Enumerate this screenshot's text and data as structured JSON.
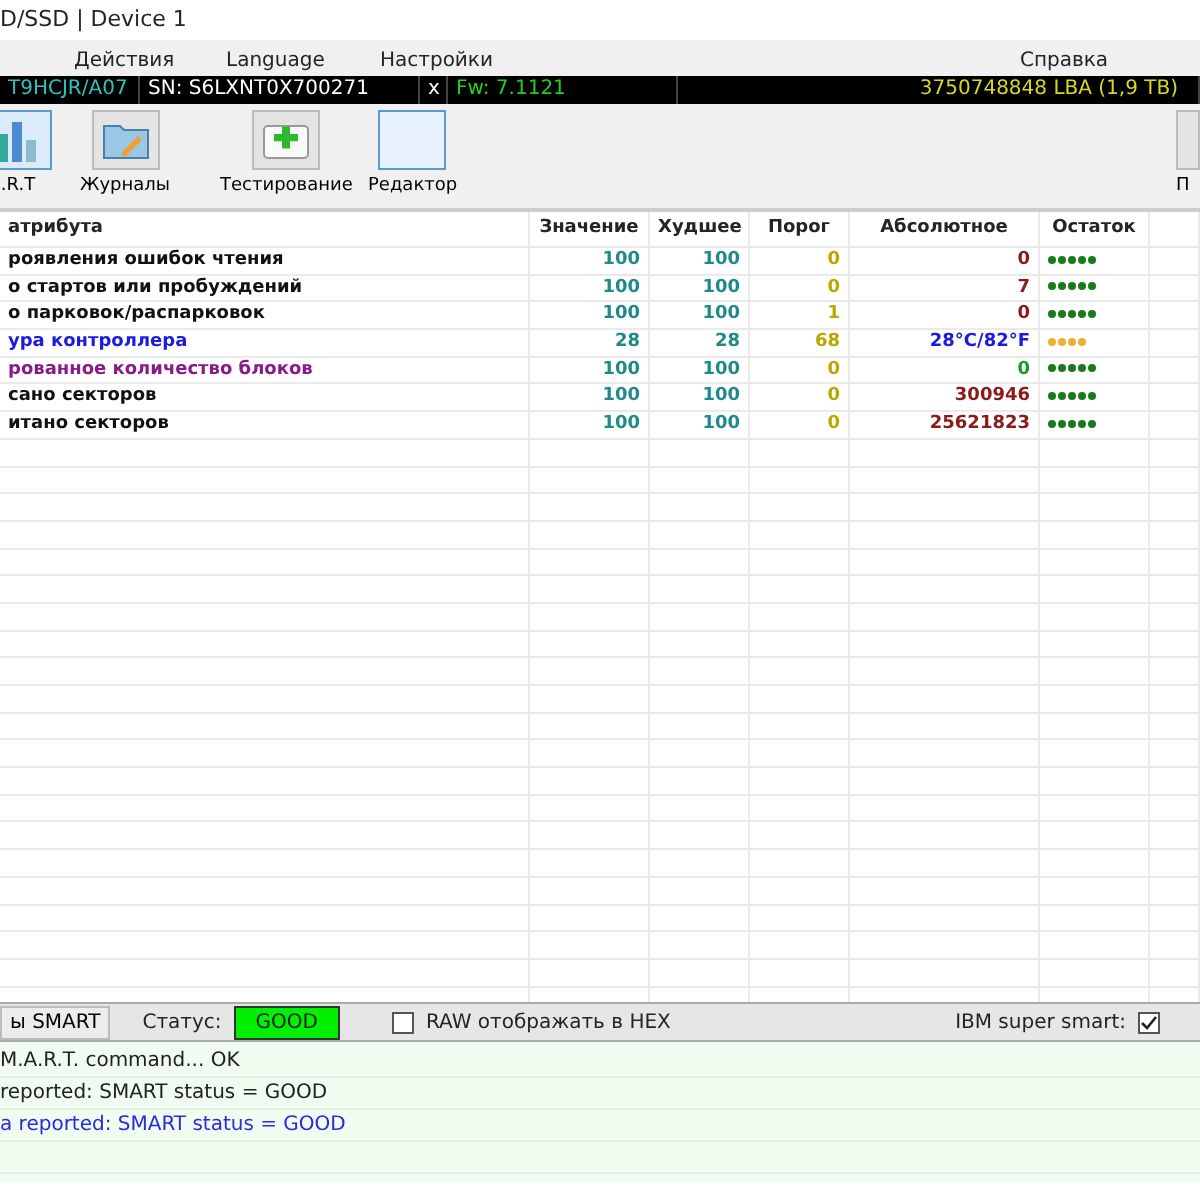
{
  "window": {
    "title": "D/SSD | Device 1"
  },
  "menu": [
    "Действия",
    "Language",
    "Настройки",
    "Справка"
  ],
  "info_bar": {
    "model": "T9HCJR/A07",
    "serial": "SN: S6LXNT0X700271",
    "close": "x",
    "firmware": "Fw: 7.1121",
    "capacity": "3750748848 LBA (1,9 TB)"
  },
  "toolbar": [
    {
      "label": ".R.T",
      "selected": true,
      "kind": "chart"
    },
    {
      "label": "Журналы",
      "selected": false,
      "kind": "folder"
    },
    {
      "label": "Тестирование",
      "selected": false,
      "kind": "kit"
    },
    {
      "label": "Редактор",
      "selected": false,
      "kind": "blank"
    },
    {
      "label": "П",
      "selected": false,
      "kind": "edge"
    }
  ],
  "table": {
    "columns": [
      "атрибута",
      "Значение",
      "Худшее",
      "Порог",
      "Абсолютное",
      "Остаток"
    ],
    "rows": [
      {
        "kind": "normal",
        "name": "роявления ошибок чтения",
        "value": "100",
        "worst": "100",
        "threshold": "0",
        "raw": "0",
        "stars": 5
      },
      {
        "kind": "normal",
        "name": "о стартов или пробуждений",
        "value": "100",
        "worst": "100",
        "threshold": "0",
        "raw": "7",
        "stars": 5
      },
      {
        "kind": "normal",
        "name": "о парковок/распарковок",
        "value": "100",
        "worst": "100",
        "threshold": "1",
        "raw": "0",
        "stars": 5
      },
      {
        "kind": "temperature",
        "name": "ура контроллера",
        "value": "28",
        "worst": "28",
        "threshold": "68",
        "raw": "28°C/82°F",
        "stars": 4
      },
      {
        "kind": "info",
        "name": "рованное количество блоков",
        "value": "100",
        "worst": "100",
        "threshold": "0",
        "raw": "0",
        "stars": 5
      },
      {
        "kind": "normal",
        "name": "сано секторов",
        "value": "100",
        "worst": "100",
        "threshold": "0",
        "raw": "300946",
        "stars": 5
      },
      {
        "kind": "normal",
        "name": "итано секторов",
        "value": "100",
        "worst": "100",
        "threshold": "0",
        "raw": "25621823",
        "stars": 5
      }
    ]
  },
  "bottom_bar": {
    "button": "ы SMART",
    "status_label": "Статус:",
    "status": "GOOD",
    "raw_hex": {
      "label": "RAW отображать в HEX",
      "checked": false
    },
    "ibm": {
      "label": "IBM super smart:",
      "checked": true
    }
  },
  "log": [
    {
      "kind": "normal",
      "text": "M.A.R.T. command... OK"
    },
    {
      "kind": "normal",
      "text": "reported: SMART status = GOOD"
    },
    {
      "kind": "highlight",
      "text": "a reported: SMART status = GOOD"
    }
  ]
}
